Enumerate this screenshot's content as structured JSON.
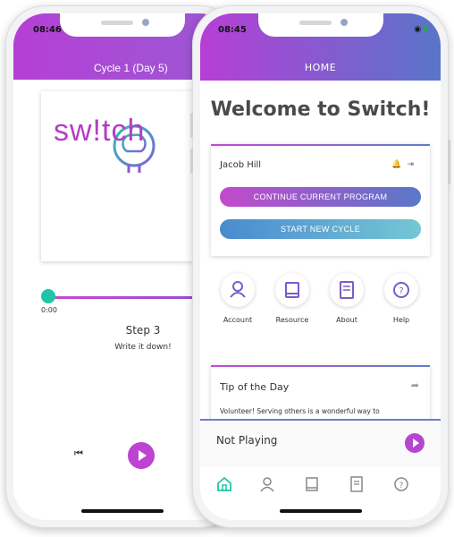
{
  "back_phone": {
    "status_time": "08:46",
    "header_title": "Cycle 1 (Day 5)",
    "logo_text": "sw!tch",
    "player": {
      "elapsed": "0:00",
      "progress": 0.0
    },
    "step_title": "Step 3",
    "step_subtitle": "Write it down!"
  },
  "front_phone": {
    "status_time": "08:45",
    "status_icons": "◉ ▮",
    "header_title": "HOME",
    "welcome": "Welcome to Switch!",
    "user_card": {
      "name": "Jacob Hill",
      "continue_label": "CONTINUE CURRENT PROGRAM",
      "new_cycle_label": "START NEW CYCLE"
    },
    "quick_links": [
      {
        "label": "Account",
        "icon": "person-icon"
      },
      {
        "label": "Resource",
        "icon": "book-icon"
      },
      {
        "label": "About",
        "icon": "document-icon"
      },
      {
        "label": "Help",
        "icon": "question-icon"
      }
    ],
    "tip": {
      "title": "Tip of the Day",
      "text": "Volunteer! Serving others is a wonderful way to"
    },
    "player": {
      "status": "Not Playing"
    },
    "tabs": [
      "home-icon",
      "person-icon",
      "book-icon",
      "document-icon",
      "question-icon"
    ]
  },
  "colors": {
    "accent_purple": "#b53fd6",
    "accent_blue": "#5875c9",
    "teal": "#1ec6a7"
  }
}
